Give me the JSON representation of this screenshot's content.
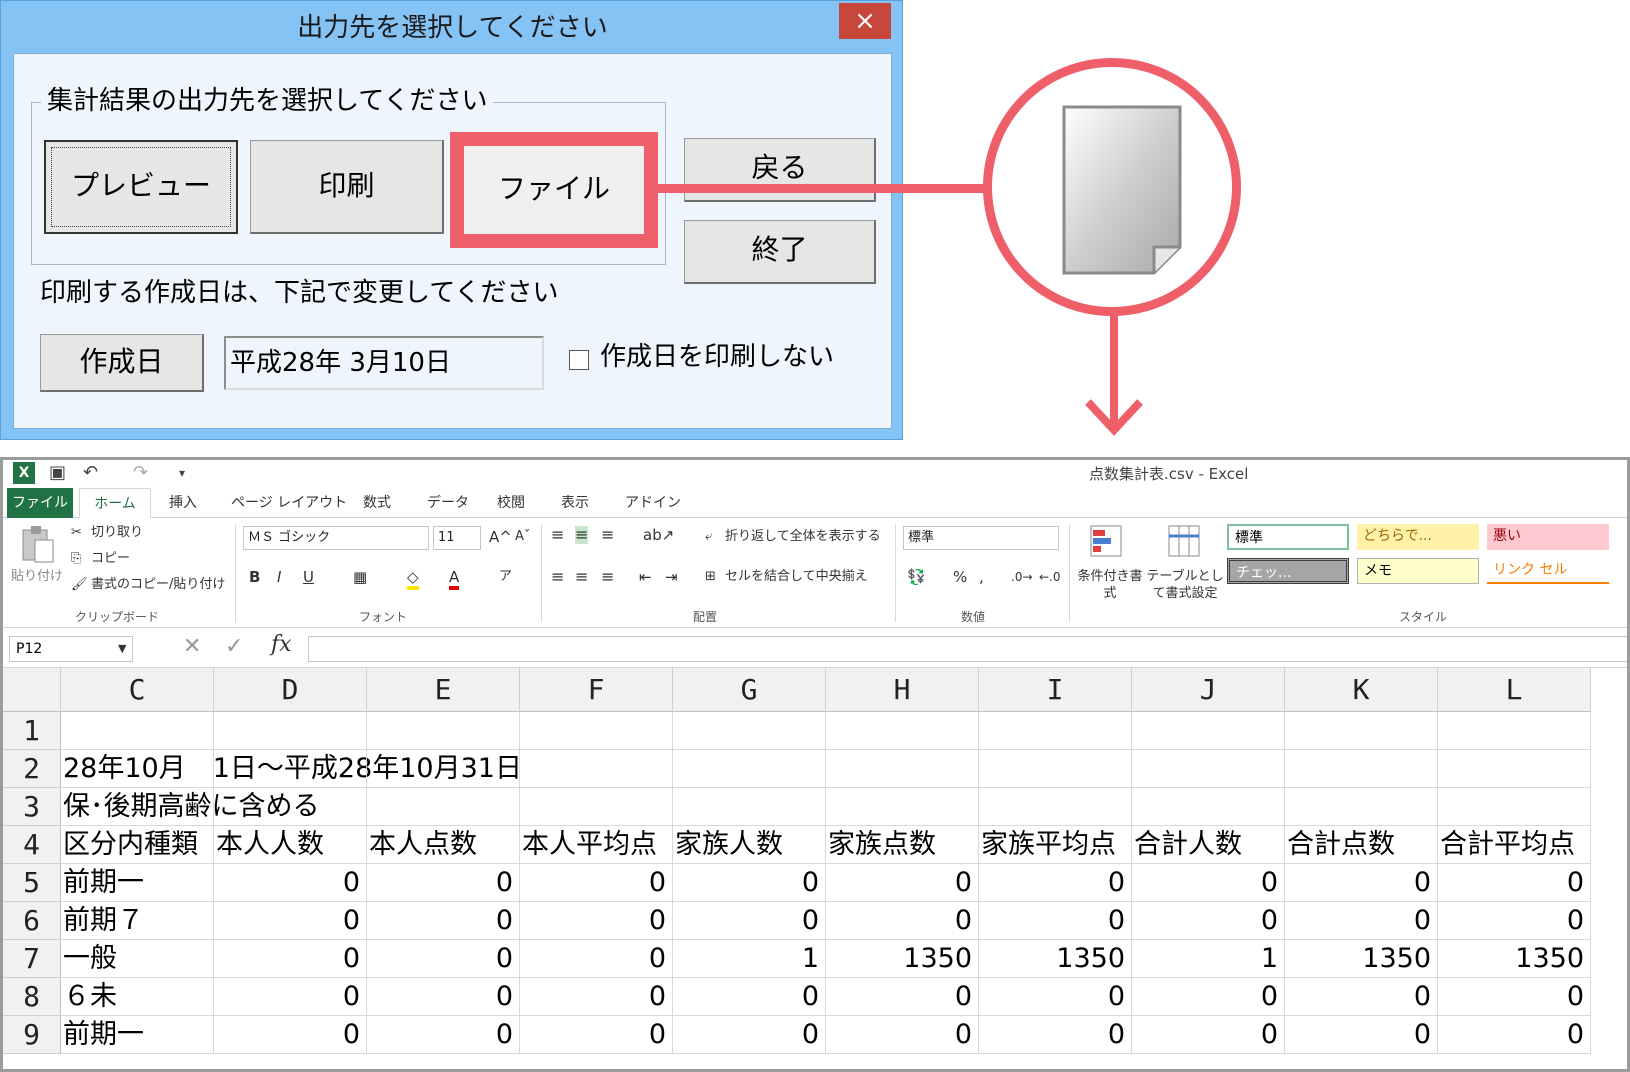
{
  "dialog": {
    "title": "出力先を選択してください",
    "close_glyph": "×",
    "group_label": "集計結果の出力先を選択してください",
    "buttons": {
      "preview": "プレビュー",
      "print": "印刷",
      "file": "ファイル",
      "back": "戻る",
      "exit": "終了"
    },
    "date_note": "印刷する作成日は、下記で変更してください",
    "created_button": "作成日",
    "date_value": "平成28年 3月10日",
    "no_print_checkbox": {
      "label": "作成日を印刷しない",
      "checked": false
    }
  },
  "callout": {
    "icon": "document-icon",
    "accent": "#ef5f69"
  },
  "excel": {
    "title": "点数集計表.csv - Excel",
    "tabs": [
      "ファイル",
      "ホーム",
      "挿入",
      "ページ レイアウト",
      "数式",
      "データ",
      "校閲",
      "表示",
      "アドイン"
    ],
    "active_tab": "ホーム",
    "ribbon": {
      "clipboard": {
        "paste": "貼り付け",
        "cut": "切り取り",
        "copy": "コピー",
        "format_painter": "書式のコピー/貼り付け",
        "group": "クリップボード"
      },
      "font": {
        "name": "ＭＳ ゴシック",
        "size": "11",
        "group": "フォント"
      },
      "alignment": {
        "wrap": "折り返して全体を表示する",
        "merge": "セルを結合して中央揃え",
        "group": "配置"
      },
      "number": {
        "format": "標準",
        "group": "数値"
      },
      "styles": {
        "conditional": "条件付き書式",
        "table": "テーブルとして書式設定",
        "cells": [
          "標準",
          "どちらで...",
          "悪い",
          "チェッ...",
          "メモ",
          "リンク セル"
        ],
        "group": "スタイル"
      }
    },
    "name_box": "P12",
    "columns": [
      "C",
      "D",
      "E",
      "F",
      "G",
      "H",
      "I",
      "J",
      "K",
      "L"
    ],
    "rows": [
      {
        "n": "1",
        "cells": [
          "",
          "",
          "",
          "",
          "",
          "",
          "",
          "",
          "",
          ""
        ]
      },
      {
        "n": "2",
        "cells": [
          "28年10月　1日～平成28年10月31日",
          "",
          "",
          "",
          "",
          "",
          "",
          "",
          "",
          ""
        ]
      },
      {
        "n": "3",
        "cells": [
          "保･後期高齢に含める",
          "",
          "",
          "",
          "",
          "",
          "",
          "",
          "",
          ""
        ]
      },
      {
        "n": "4",
        "cells": [
          "区分内種類",
          "本人人数",
          "本人点数",
          "本人平均点",
          "家族人数",
          "家族点数",
          "家族平均点",
          "合計人数",
          "合計点数",
          "合計平均点"
        ]
      },
      {
        "n": "5",
        "cells": [
          "前期一",
          "0",
          "0",
          "0",
          "0",
          "0",
          "0",
          "0",
          "0",
          "0"
        ]
      },
      {
        "n": "6",
        "cells": [
          "前期７",
          "0",
          "0",
          "0",
          "0",
          "0",
          "0",
          "0",
          "0",
          "0"
        ]
      },
      {
        "n": "7",
        "cells": [
          "一般",
          "0",
          "0",
          "0",
          "1",
          "1350",
          "1350",
          "1",
          "1350",
          "1350"
        ]
      },
      {
        "n": "8",
        "cells": [
          "６未",
          "0",
          "0",
          "0",
          "0",
          "0",
          "0",
          "0",
          "0",
          "0"
        ]
      },
      {
        "n": "9",
        "cells": [
          "前期一",
          "0",
          "0",
          "0",
          "0",
          "0",
          "0",
          "0",
          "0",
          "0"
        ]
      }
    ]
  }
}
